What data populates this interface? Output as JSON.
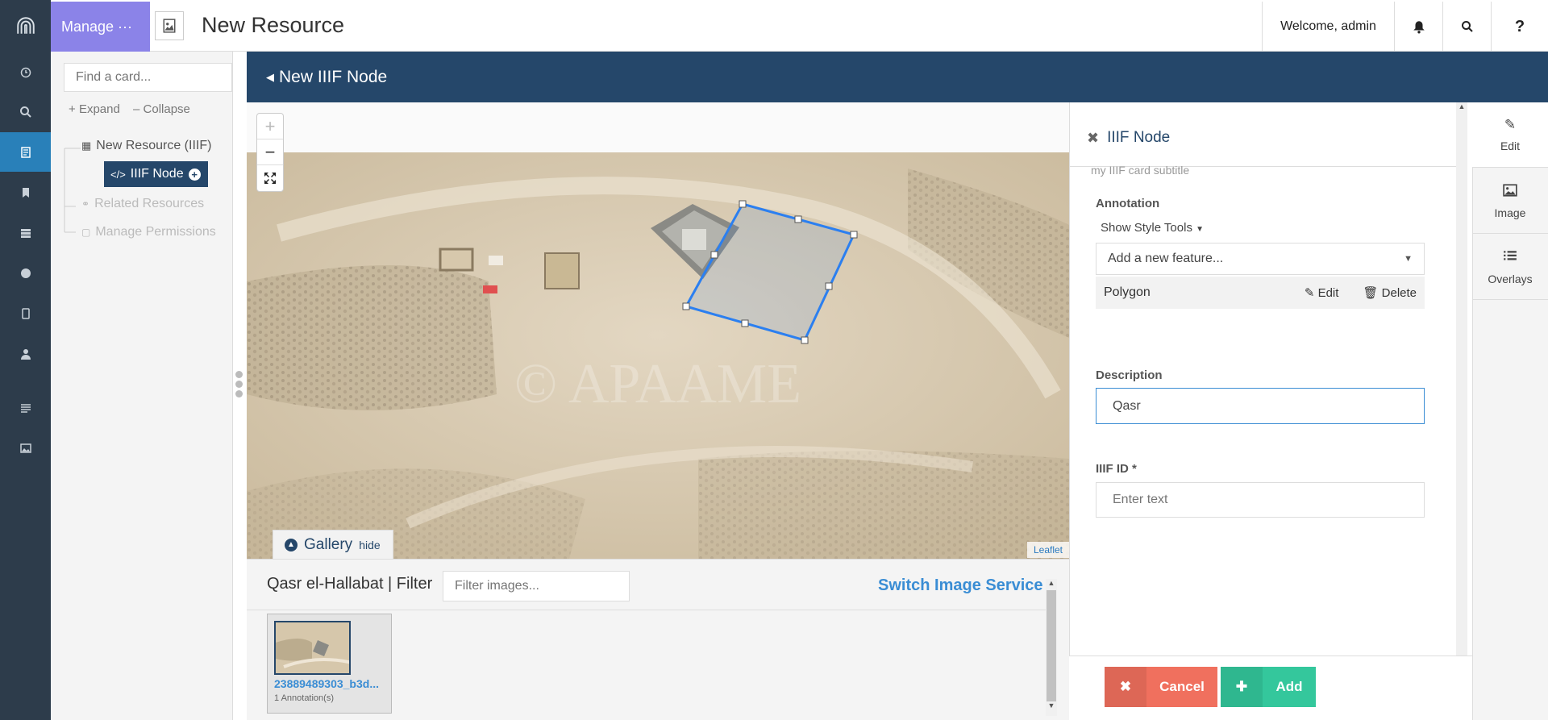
{
  "nav": {
    "items": [
      {
        "name": "dashboard"
      },
      {
        "name": "search"
      },
      {
        "name": "resource-editor"
      },
      {
        "name": "bookmarks"
      },
      {
        "name": "database"
      },
      {
        "name": "map"
      },
      {
        "name": "phone"
      },
      {
        "name": "user"
      },
      {
        "name": "list"
      },
      {
        "name": "images"
      }
    ]
  },
  "header": {
    "manage_label": "Manage ···",
    "title": "New Resource",
    "welcome": "Welcome, admin",
    "help": "?"
  },
  "tree": {
    "search_placeholder": "Find a card...",
    "expand": "Expand",
    "collapse": "Collapse",
    "root": "New Resource (IIIF)",
    "node": "IIIF Node",
    "related": "Related Resources",
    "permissions": "Manage Permissions"
  },
  "main": {
    "bar_title": "New IIIF Node"
  },
  "map": {
    "zoom_in": "+",
    "zoom_out": "−",
    "gallery_label": "Gallery",
    "gallery_hide": "hide",
    "attribution": "Leaflet",
    "watermark": "© APAAME"
  },
  "gallery": {
    "label": "Qasr el-Hallabat | Filter",
    "filter_placeholder": "Filter images...",
    "switch_service": "Switch Image Service",
    "thumb_name": "23889489303_b3d...",
    "thumb_annotations": "1 Annotation(s)"
  },
  "form": {
    "title": "IIIF Node",
    "subtitle": "my IIIF card subtitle",
    "annotation_label": "Annotation",
    "style_tools": "Show Style Tools",
    "feature_placeholder": "Add a new feature...",
    "feature_name": "Polygon",
    "edit": "Edit",
    "delete": "Delete",
    "description_label": "Description",
    "description_value": "Qasr",
    "iiif_id_label": "IIIF ID",
    "iiif_id_placeholder": "Enter text",
    "cancel": "Cancel",
    "add": "Add"
  },
  "side_tools": {
    "edit": "Edit",
    "image": "Image",
    "overlays": "Overlays"
  },
  "colors": {
    "nav_bg": "#2d3c4b",
    "nav_active": "#2980b9",
    "manage": "#8b83e8",
    "main_bar": "#25476a",
    "link": "#3a8dd4",
    "cancel": "#f0705e",
    "add": "#34c79c",
    "polygon": "#2b7ff0"
  }
}
